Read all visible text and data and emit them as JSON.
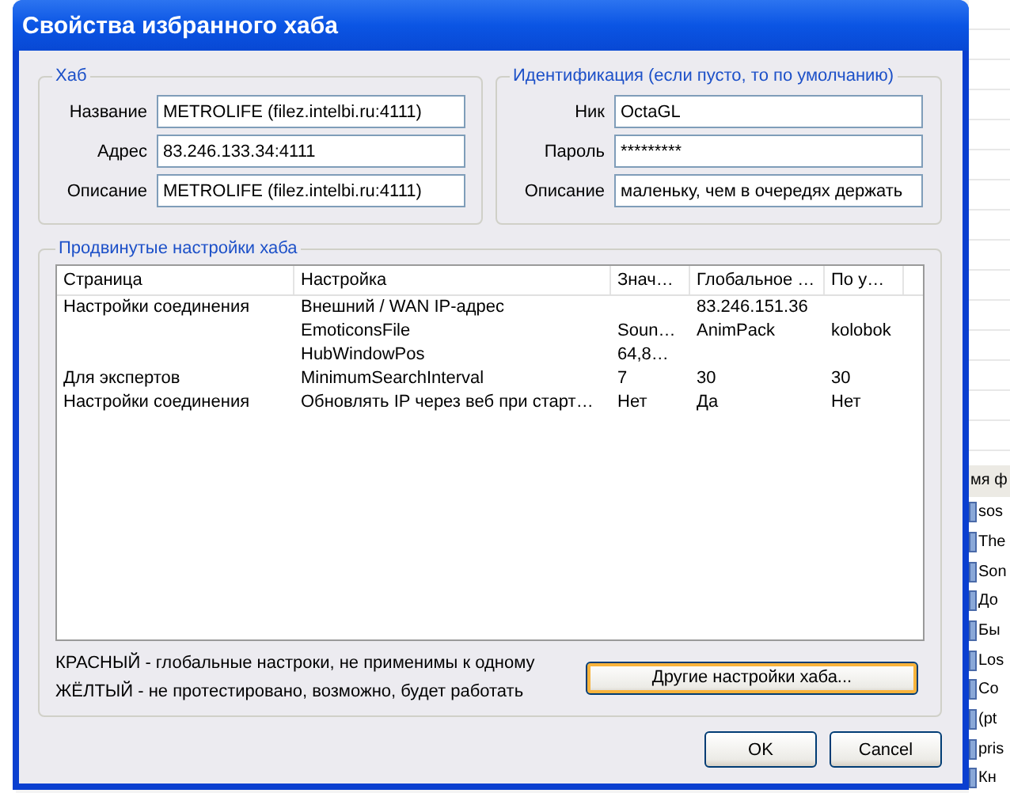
{
  "window": {
    "title": "Свойства избранного хаба"
  },
  "hub_group": {
    "title": "Хаб",
    "fields": [
      {
        "label": "Название",
        "value": "METROLIFE (filez.intelbi.ru:4111)"
      },
      {
        "label": "Адрес",
        "value": "83.246.133.34:4111"
      },
      {
        "label": "Описание",
        "value": "METROLIFE (filez.intelbi.ru:4111)"
      }
    ]
  },
  "identity_group": {
    "title": "Идентификация (если пусто, то по умолчанию)",
    "fields": [
      {
        "label": "Ник",
        "value": "OctaGL"
      },
      {
        "label": "Пароль",
        "value": "*********"
      },
      {
        "label": "Описание",
        "value": "маленьку, чем в очередях держать"
      }
    ]
  },
  "advanced_group": {
    "title": "Продвинутые настройки хаба",
    "columns": [
      "Страница",
      "Настройка",
      "Знач…",
      "Глобальное …",
      "По у…"
    ],
    "rows": [
      {
        "page": "Настройки соединения",
        "setting": "Внешний / WAN IP-адрес",
        "global": "83.246.151.36"
      },
      {
        "setting": "EmoticonsFile",
        "value": "Soun…",
        "global": "AnimPack",
        "default": "kolobok"
      },
      {
        "setting": "HubWindowPos",
        "value": "64,8…"
      },
      {
        "page": "Для экспертов",
        "setting": "MinimumSearchInterval",
        "value": "7",
        "global": "30",
        "default": "30"
      },
      {
        "page": "Настройки соединения",
        "setting": "Обновлять IP через веб при старт…",
        "value": "Нет",
        "global": "Да",
        "default": "Нет"
      }
    ],
    "legend": [
      "КРАСНЫЙ - глобальные настроки, не применимы к одному",
      "ЖЁЛТЫЙ - не протестировано, возможно, будет работать"
    ],
    "other_settings_button": "Другие настройки хаба..."
  },
  "buttons": [
    "OK",
    "Cancel"
  ],
  "background_list": {
    "header": "мя ф",
    "items": [
      "sos",
      "The",
      "Son",
      "До",
      "Бы",
      "Los",
      "Co",
      "(pt",
      "pris",
      "Кн"
    ]
  }
}
